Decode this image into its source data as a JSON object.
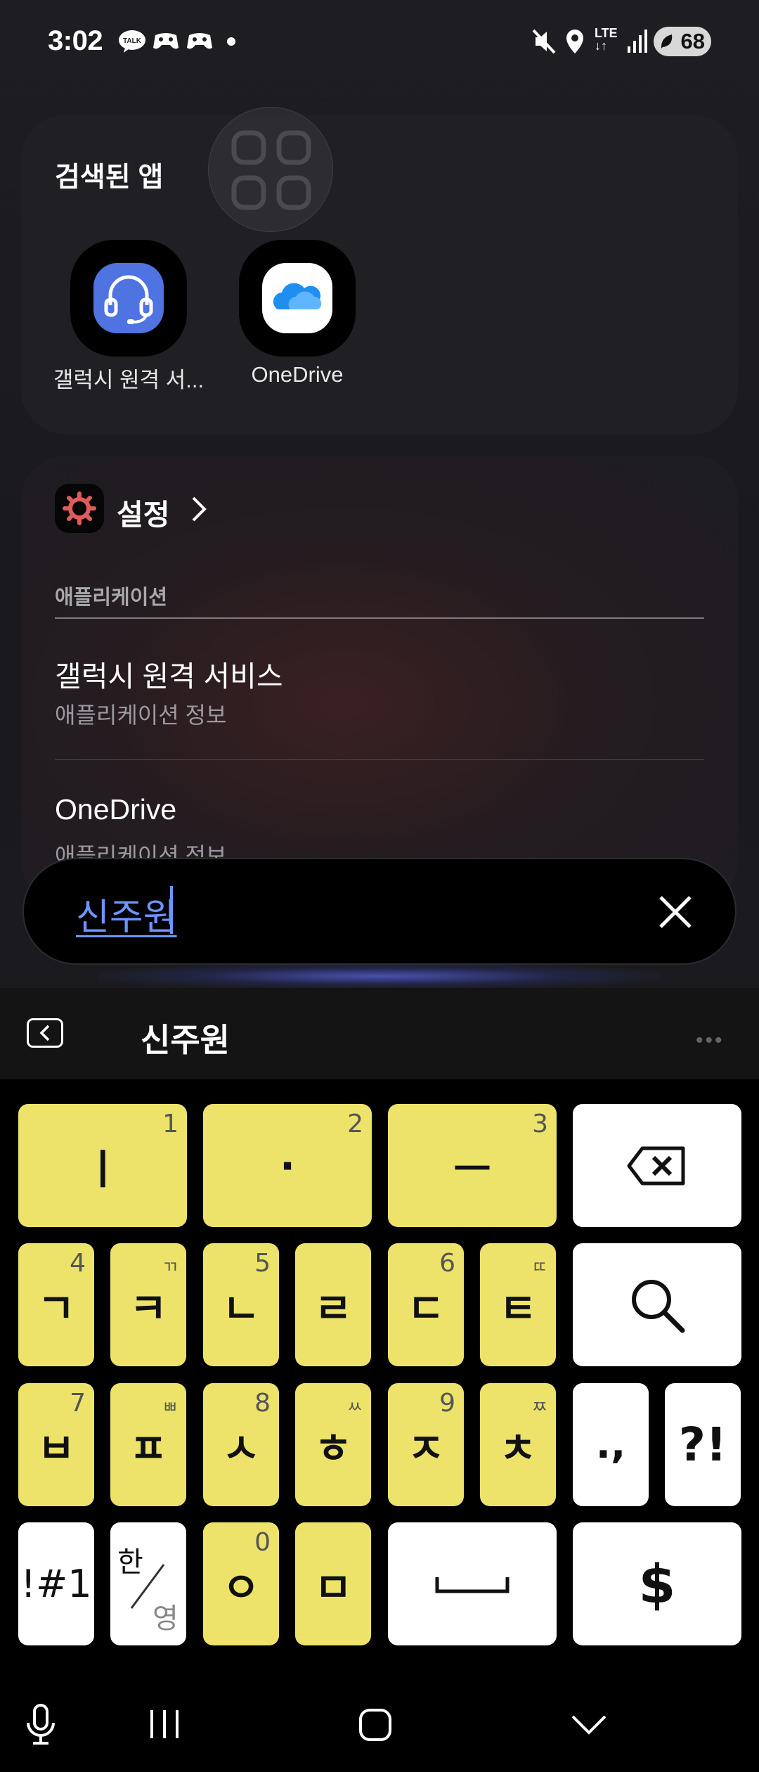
{
  "status_bar": {
    "time": "3:02",
    "notification_icons": [
      "kakaotalk-icon",
      "game-icon",
      "game-icon",
      "dot-icon"
    ],
    "system_icons": [
      "mute-icon",
      "location-icon",
      "lte-icon",
      "signal-icon"
    ],
    "lte_label": "LTE",
    "battery": "68"
  },
  "searched_apps": {
    "title": "검색된 앱",
    "apps": [
      {
        "label": "갤럭시 원격 서...",
        "icon": "headset-icon"
      },
      {
        "label": "OneDrive",
        "icon": "cloud-icon"
      }
    ]
  },
  "settings_section": {
    "title": "설정",
    "category": "애플리케이션",
    "results": [
      {
        "title": "갤럭시 원격 서비스",
        "subtitle": "애플리케이션 정보"
      },
      {
        "title": "OneDrive",
        "subtitle": "애플리케이션 정보"
      }
    ]
  },
  "search_bar": {
    "value": "신주원"
  },
  "keyboard": {
    "candidate": "신주원",
    "rows": [
      [
        {
          "main": "ㅣ",
          "sub": "1"
        },
        {
          "main": "·",
          "sub": "2"
        },
        {
          "main": "ㅡ",
          "sub": "3"
        },
        {
          "icon": "backspace-icon"
        }
      ],
      [
        {
          "main": "ㄱ",
          "sub": "4"
        },
        {
          "main": "ㅋ",
          "sub": "ㄲ"
        },
        {
          "main": "ㄴ",
          "sub": "5"
        },
        {
          "main": "ㄹ",
          "sub": ""
        },
        {
          "main": "ㄷ",
          "sub": "6"
        },
        {
          "main": "ㅌ",
          "sub": "ㄸ"
        },
        {
          "icon": "search-icon"
        }
      ],
      [
        {
          "main": "ㅂ",
          "sub": "7"
        },
        {
          "main": "ㅍ",
          "sub": "ㅃ"
        },
        {
          "main": "ㅅ",
          "sub": "8"
        },
        {
          "main": "ㅎ",
          "sub": "ㅆ"
        },
        {
          "main": "ㅈ",
          "sub": "9"
        },
        {
          "main": "ㅊ",
          "sub": "ㅉ"
        },
        {
          "main": ".,"
        },
        {
          "main": "?!"
        }
      ],
      [
        {
          "main": "!#1"
        },
        {
          "main_top": "한",
          "main_bottom": "영"
        },
        {
          "main": "ㅇ",
          "sub": "0"
        },
        {
          "main": "ㅁ",
          "sub": ""
        },
        {
          "icon": "space-icon"
        },
        {
          "main": "$"
        }
      ]
    ],
    "colors": {
      "yellow_key": "#ede36a",
      "white_key": "#ffffff",
      "background": "#000000"
    }
  },
  "nav_bar": {
    "buttons": [
      "microphone-icon",
      "recents-icon",
      "home-icon",
      "hide-keyboard-icon"
    ]
  },
  "accent_color": "#6c95ff"
}
